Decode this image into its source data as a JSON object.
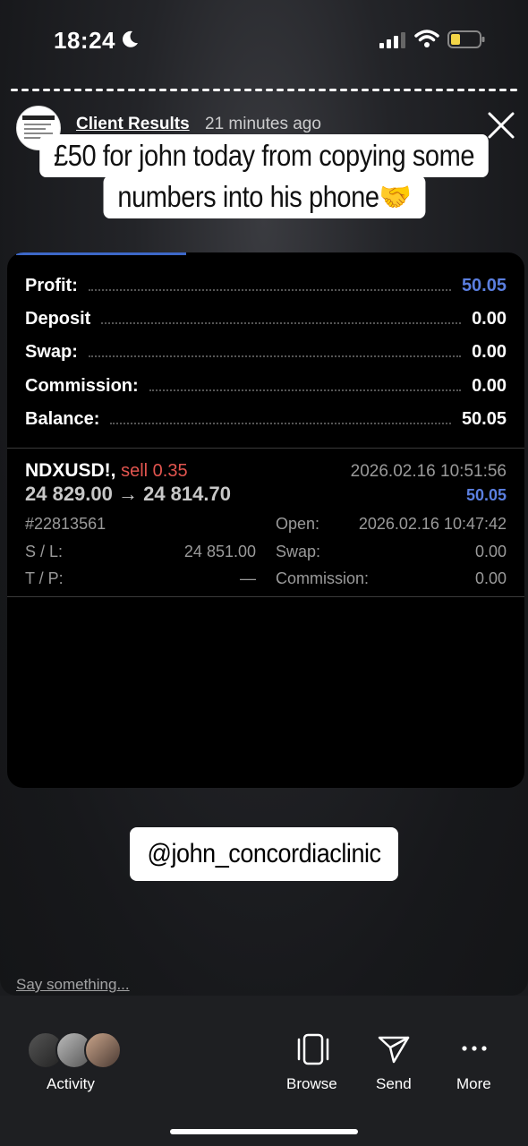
{
  "status_bar": {
    "time": "18:24"
  },
  "story": {
    "user": "Client Results",
    "time_ago": "21 minutes ago",
    "caption_line1": "£50 for john today from copying some",
    "caption_line2": "numbers into his phone🤝",
    "mention": "@john_concordiaclinic"
  },
  "summary": {
    "rows": [
      {
        "label": "Profit:",
        "value": "50.05"
      },
      {
        "label": "Deposit",
        "value": "0.00"
      },
      {
        "label": "Swap:",
        "value": "0.00"
      },
      {
        "label": "Commission:",
        "value": "0.00"
      },
      {
        "label": "Balance:",
        "value": "50.05"
      }
    ]
  },
  "trade": {
    "symbol": "NDXUSD!,",
    "side": "sell 0.35",
    "prices": "24 829.00 → 24 814.70",
    "close_time": "2026.02.16 10:51:56",
    "profit": "50.05",
    "ticket": "#22813561",
    "open_label": "Open:",
    "open_time": "2026.02.16 10:47:42",
    "sl_label": "S / L:",
    "sl_value": "24 851.00",
    "swap_label": "Swap:",
    "swap_value": "0.00",
    "tp_label": "T / P:",
    "tp_value": "—",
    "commission_label": "Commission:",
    "commission_value": "0.00"
  },
  "reply": {
    "placeholder": "Say something..."
  },
  "actions": {
    "activity": "Activity",
    "browse": "Browse",
    "send": "Send",
    "more": "More"
  }
}
